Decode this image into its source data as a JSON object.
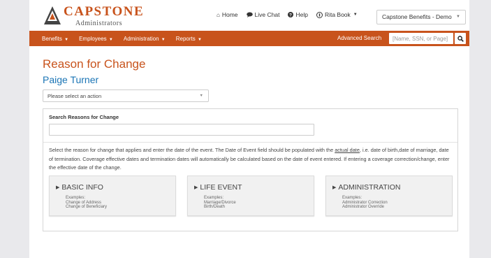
{
  "brand": {
    "name": "CAPSTONE",
    "subtitle": "Administrators",
    "accent_color": "#c8531c",
    "link_color": "#1a74b5"
  },
  "top_links": [
    {
      "icon": "home-icon",
      "label": "Home"
    },
    {
      "icon": "chat-bubble-icon",
      "label": "Live Chat"
    },
    {
      "icon": "question-circle-icon",
      "label": "Help"
    },
    {
      "icon": "user-badge-icon",
      "label": "Rita Book"
    }
  ],
  "client_select": {
    "value": "Capstone Benefits - Demo"
  },
  "nav": {
    "items": [
      "Benefits",
      "Employees",
      "Administration",
      "Reports"
    ],
    "advanced_search": "Advanced Search",
    "search_placeholder": "[Name, SSN, or Page]"
  },
  "page": {
    "title": "Reason for Change",
    "person_name": "Paige Turner",
    "action_select": "Please select an action"
  },
  "search": {
    "label": "Search Reasons for Change",
    "value": ""
  },
  "instructions": {
    "part1": "Select the reason for change that applies and enter the date of the event. The Date of Event field should be populated with the ",
    "link": "actual date",
    "part2": ", i.e. date of birth,date of marriage, date of termination. Coverage effective dates and termination dates will automatically be calculated based on the date of event entered. If entering a coverage correction/change, enter the effective date of the change."
  },
  "cards": [
    {
      "title": "BASIC INFO",
      "examples_label": "Examples:",
      "examples": [
        "Change of Address",
        "Change of Beneficiary"
      ]
    },
    {
      "title": "LIFE EVENT",
      "examples_label": "Examples:",
      "examples": [
        "Marriage/Divorce",
        "Birth/Death"
      ]
    },
    {
      "title": "ADMINISTRATION",
      "examples_label": "Examples:",
      "examples": [
        "Administrator Correction",
        "Administrator Override"
      ]
    }
  ]
}
